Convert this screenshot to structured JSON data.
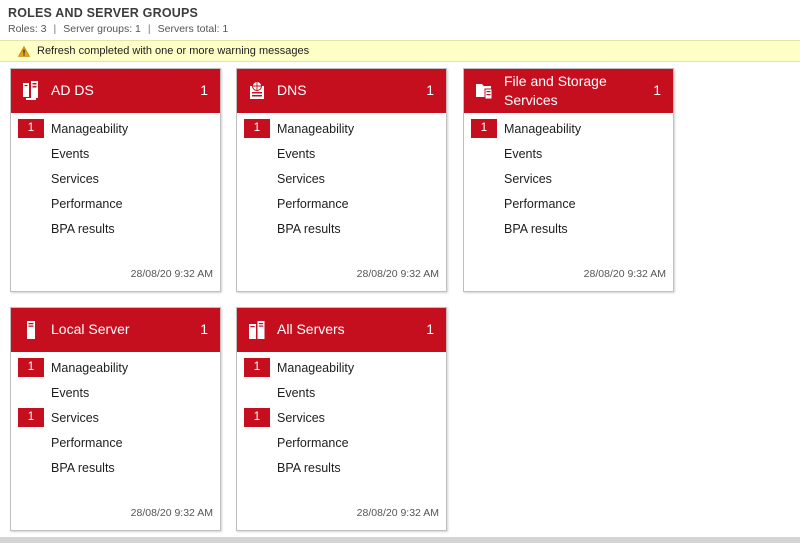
{
  "header": {
    "title": "ROLES AND SERVER GROUPS",
    "roles": "Roles: 3",
    "server_groups": "Server groups: 1",
    "servers_total": "Servers total: 1",
    "separator": "|"
  },
  "warning": {
    "text": "Refresh completed with one or more warning messages",
    "icon": "warning-icon"
  },
  "colors": {
    "accent": "#c50f1f",
    "warning_bg": "#fefec7"
  },
  "tiles": [
    {
      "name": "AD DS",
      "count": "1",
      "icon": "ad-ds-icon",
      "rows": [
        {
          "label": "Manageability",
          "badge": "1"
        },
        {
          "label": "Events",
          "badge": ""
        },
        {
          "label": "Services",
          "badge": ""
        },
        {
          "label": "Performance",
          "badge": ""
        },
        {
          "label": "BPA results",
          "badge": ""
        }
      ],
      "timestamp": "28/08/20 9:32 AM"
    },
    {
      "name": "DNS",
      "count": "1",
      "icon": "dns-icon",
      "rows": [
        {
          "label": "Manageability",
          "badge": "1"
        },
        {
          "label": "Events",
          "badge": ""
        },
        {
          "label": "Services",
          "badge": ""
        },
        {
          "label": "Performance",
          "badge": ""
        },
        {
          "label": "BPA results",
          "badge": ""
        }
      ],
      "timestamp": "28/08/20 9:32 AM"
    },
    {
      "name": "File and Storage Services",
      "count": "1",
      "icon": "file-storage-icon",
      "rows": [
        {
          "label": "Manageability",
          "badge": "1"
        },
        {
          "label": "Events",
          "badge": ""
        },
        {
          "label": "Services",
          "badge": ""
        },
        {
          "label": "Performance",
          "badge": ""
        },
        {
          "label": "BPA results",
          "badge": ""
        }
      ],
      "timestamp": "28/08/20 9:32 AM"
    },
    {
      "name": "Local Server",
      "count": "1",
      "icon": "local-server-icon",
      "rows": [
        {
          "label": "Manageability",
          "badge": "1"
        },
        {
          "label": "Events",
          "badge": ""
        },
        {
          "label": "Services",
          "badge": "1"
        },
        {
          "label": "Performance",
          "badge": ""
        },
        {
          "label": "BPA results",
          "badge": ""
        }
      ],
      "timestamp": "28/08/20 9:32 AM"
    },
    {
      "name": "All Servers",
      "count": "1",
      "icon": "all-servers-icon",
      "rows": [
        {
          "label": "Manageability",
          "badge": "1"
        },
        {
          "label": "Events",
          "badge": ""
        },
        {
          "label": "Services",
          "badge": "1"
        },
        {
          "label": "Performance",
          "badge": ""
        },
        {
          "label": "BPA results",
          "badge": ""
        }
      ],
      "timestamp": "28/08/20 9:32 AM"
    }
  ]
}
